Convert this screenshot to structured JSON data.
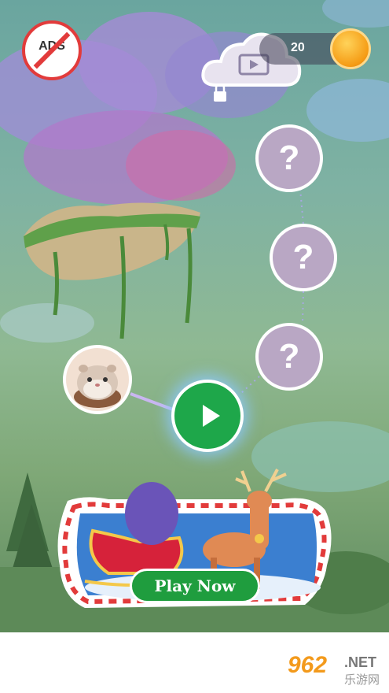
{
  "top_bar": {
    "no_ads_label": "ADS",
    "coin_count": "20"
  },
  "level_map": {
    "locked_levels": [
      {
        "label": "?"
      },
      {
        "label": "?"
      },
      {
        "label": "?"
      }
    ]
  },
  "promo_banner": {
    "play_now_label": "Play Now"
  },
  "watermark": {
    "number": "962",
    "domain": ".NET",
    "subtitle": "乐游网"
  },
  "icons": [
    "no-ads-icon",
    "video-icon",
    "lock-icon",
    "coin-icon",
    "play-icon",
    "hamster-avatar-icon",
    "reindeer-icon",
    "sleigh-icon"
  ],
  "colors": {
    "play_green": "#1ea74a",
    "lock_circle": "#b9a7c4",
    "coin": "#f5a623",
    "no_ads_red": "#e23b3b"
  }
}
